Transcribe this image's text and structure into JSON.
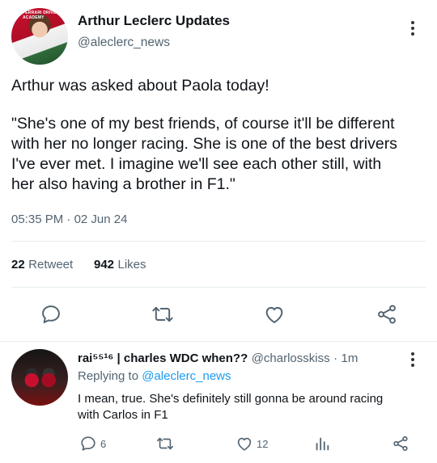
{
  "tweet": {
    "author_name": "Arthur Leclerc Updates",
    "author_handle": "@aleclerc_news",
    "avatar_text": "FERRARI DRIVER ACADEMY",
    "text_line1": "Arthur was asked about Paola today!",
    "text_line2": "\"She's one of my best friends, of course it'll be different",
    "text_line3": "with her no longer racing. She is one of the best drivers",
    "text_line4": "I've ever met. I imagine we'll see each other still, with",
    "text_line5": "her also having a brother in F1.\"",
    "time": "05:35 PM",
    "separator": "·",
    "date": "02 Jun 24",
    "retweets_count": "22",
    "retweets_label": "Retweet",
    "likes_count": "942",
    "likes_label": "Likes"
  },
  "actions": {
    "icons": [
      "reply-icon",
      "retweet-icon",
      "like-icon",
      "share-icon"
    ]
  },
  "reply": {
    "name": "rai⁵⁵¹⁶ | charles WDC when??",
    "handle": "@charlosskiss",
    "separator": "·",
    "time": "1m",
    "replying_to_label": "Replying to",
    "replying_to_handle": "@aleclerc_news",
    "text_line1": "I mean, true. She's definitely still gonna be around racing",
    "text_line2": "with Carlos in F1",
    "reply_count": "6",
    "like_count": "12"
  },
  "colors": {
    "accent": "#1d9bf0",
    "secondary_text": "#536471",
    "icon": "#536471"
  }
}
